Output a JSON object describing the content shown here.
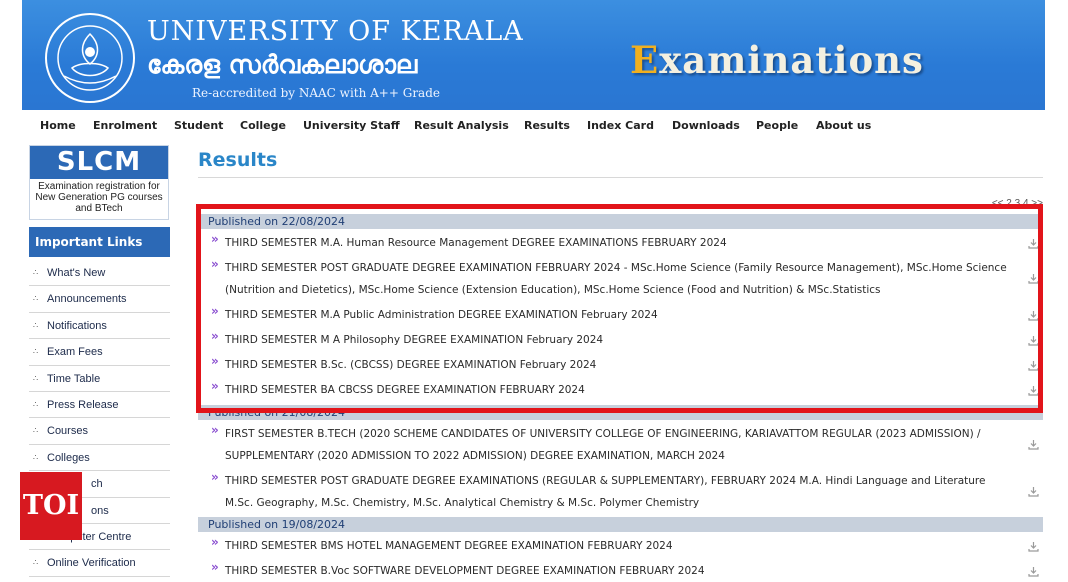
{
  "header": {
    "university_en": "UNIVERSITY OF KERALA",
    "university_ml": "കേരള സർവകലാശാല",
    "accreditation": "Re-accredited by NAAC with A++ Grade",
    "section_title_first": "E",
    "section_title_rest": "xaminations",
    "colors": {
      "banner": "#2a7ad6",
      "title_gold": "#f0b020"
    }
  },
  "nav": [
    "Home",
    "Enrolment",
    "Student",
    "College",
    "University Staff",
    "Result Analysis",
    "Results",
    "Index Card",
    "Downloads",
    "People",
    "About us"
  ],
  "sidebar": {
    "slcm_title": "SLCM",
    "slcm_desc_line1": "Examination registration for",
    "slcm_desc_line2": "New Generation PG courses",
    "slcm_desc_line3": "and BTech",
    "important_links_title": "Important Links",
    "links": [
      "What's New",
      "Announcements",
      "Notifications",
      "Exam Fees",
      "Time Table",
      "Press Release",
      "Courses",
      "Colleges",
      "ch",
      "ons",
      "Computer Centre",
      "Online Verification"
    ]
  },
  "main": {
    "title": "Results",
    "pager": "<< 2 3 4 >>",
    "groups": [
      {
        "published": "Published on 22/08/2024",
        "items": [
          {
            "lines": [
              "THIRD SEMESTER M.A. Human Resource Management DEGREE EXAMINATIONS FEBRUARY 2024"
            ]
          },
          {
            "lines": [
              "THIRD SEMESTER POST GRADUATE DEGREE EXAMINATION FEBRUARY 2024 - MSc.Home Science (Family Resource Management), MSc.Home Science",
              "(Nutrition and Dietetics), MSc.Home Science (Extension Education), MSc.Home Science (Food and Nutrition) & MSc.Statistics"
            ]
          },
          {
            "lines": [
              "THIRD SEMESTER M.A Public Administration DEGREE EXAMINATION February 2024"
            ]
          },
          {
            "lines": [
              "THIRD SEMESTER M A Philosophy DEGREE EXAMINATION February 2024"
            ]
          },
          {
            "lines": [
              "THIRD SEMESTER B.Sc. (CBCSS) DEGREE EXAMINATION February 2024"
            ]
          },
          {
            "lines": [
              "THIRD SEMESTER BA CBCSS DEGREE EXAMINATION FEBRUARY 2024"
            ]
          }
        ]
      },
      {
        "published": "Published on 21/08/2024",
        "items": [
          {
            "lines": [
              "FIRST SEMESTER B.TECH (2020 SCHEME CANDIDATES OF UNIVERSITY COLLEGE OF ENGINEERING, KARIAVATTOM REGULAR (2023 ADMISSION) /",
              "SUPPLEMENTARY (2020 ADMISSION TO 2022 ADMISSION) DEGREE EXAMINATION, MARCH 2024"
            ]
          },
          {
            "lines": [
              "THIRD SEMESTER POST GRADUATE DEGREE EXAMINATIONS (REGULAR & SUPPLEMENTARY), FEBRUARY 2024 M.A. Hindi Language and Literature",
              "M.Sc. Geography, M.Sc. Chemistry, M.Sc. Analytical Chemistry & M.Sc. Polymer Chemistry"
            ]
          }
        ]
      },
      {
        "published": "Published on 19/08/2024",
        "items": [
          {
            "lines": [
              "THIRD SEMESTER BMS HOTEL MANAGEMENT DEGREE EXAMINATION FEBRUARY 2024"
            ]
          },
          {
            "lines": [
              "THIRD SEMESTER B.Voc SOFTWARE DEVELOPMENT DEGREE EXAMINATION FEBRUARY 2024"
            ]
          }
        ]
      }
    ]
  },
  "watermark": "TOI",
  "colors": {
    "highlight_border": "#e2141a",
    "group_header": "#c7d0dc",
    "arrow": "#8a4fd0",
    "title_blue": "#2a86c8"
  }
}
